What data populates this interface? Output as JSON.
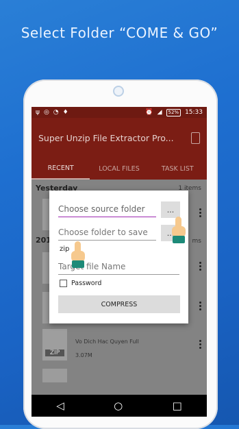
{
  "headline": "Select Folder “COME & GO”",
  "status_bar": {
    "battery": "52%",
    "time": "15:33"
  },
  "toolbar": {
    "title": "Super Unzip File Extractor Pro..."
  },
  "tabs": [
    "RECENT",
    "LOCAL FILES",
    "TASK LIST"
  ],
  "list": {
    "section1": {
      "label": "Yesterday",
      "count": "1 items"
    },
    "section2": {
      "label": "201",
      "count": "ms"
    },
    "zip_item": {
      "thumb_label": "ZIP",
      "title": "Vo Dich Hac Quyen Full",
      "size": "3.07M"
    }
  },
  "dialog": {
    "source_placeholder": "Choose source folder",
    "save_placeholder": "Choose folder to save",
    "browse_label": "...",
    "zip_suffix": "zip",
    "target_placeholder": "Target file Name",
    "password_label": "Password",
    "compress_label": "COMPRESS"
  },
  "navbar": {
    "back": "◁",
    "home": "○",
    "recent": "□"
  }
}
